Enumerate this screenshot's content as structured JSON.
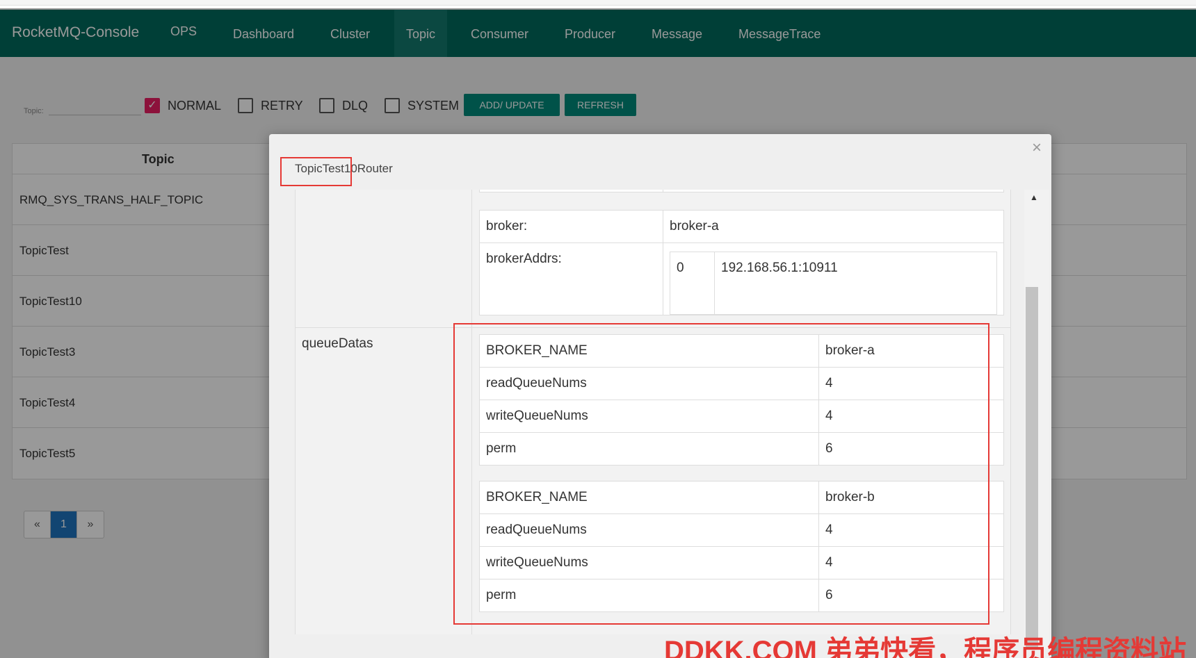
{
  "app": {
    "brand": "RocketMQ-Console"
  },
  "nav": {
    "ops": "OPS",
    "items": [
      "Dashboard",
      "Cluster",
      "Topic",
      "Consumer",
      "Producer",
      "Message",
      "MessageTrace"
    ],
    "active": "Topic"
  },
  "filters": {
    "topic_label": "Topic:",
    "topic_value": "",
    "checkboxes": [
      {
        "label": "NORMAL",
        "checked": true
      },
      {
        "label": "RETRY",
        "checked": false
      },
      {
        "label": "DLQ",
        "checked": false
      },
      {
        "label": "SYSTEM",
        "checked": false
      }
    ],
    "add_update_label": "ADD/ UPDATE",
    "refresh_label": "REFRESH"
  },
  "topic_table": {
    "header": "Topic",
    "rows": [
      "RMQ_SYS_TRANS_HALF_TOPIC",
      "TopicTest",
      "TopicTest10",
      "TopicTest3",
      "TopicTest4",
      "TopicTest5"
    ]
  },
  "pagination": {
    "prev": "«",
    "current": "1",
    "next": "»"
  },
  "modal": {
    "title": "TopicTest10Router",
    "close": "×",
    "broker": {
      "broker_key": "broker:",
      "broker_value": "broker-a",
      "addrs_key": "brokerAddrs:",
      "addr_index": "0",
      "addr_value": "192.168.56.1:10911"
    },
    "queue_label": "queueDatas",
    "queue_datas": [
      {
        "rows": [
          [
            "BROKER_NAME",
            "broker-a"
          ],
          [
            "readQueueNums",
            "4"
          ],
          [
            "writeQueueNums",
            "4"
          ],
          [
            "perm",
            "6"
          ]
        ]
      },
      {
        "rows": [
          [
            "BROKER_NAME",
            "broker-b"
          ],
          [
            "readQueueNums",
            "4"
          ],
          [
            "writeQueueNums",
            "4"
          ],
          [
            "perm",
            "6"
          ]
        ]
      }
    ]
  },
  "watermark": "DDKK.COM 弟弟快看，程序员编程资料站",
  "colors": {
    "navbar": "#00695c",
    "button": "#00897b",
    "highlight": "#e53935",
    "checkbox": "#e91e63"
  }
}
